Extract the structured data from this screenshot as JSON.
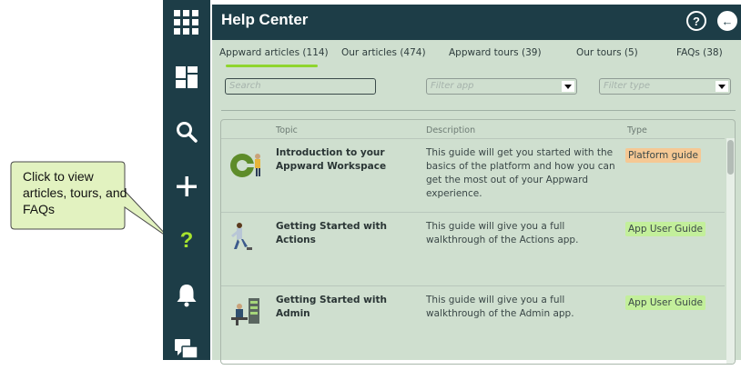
{
  "callout": {
    "text": "Click to view articles, tours, and FAQs"
  },
  "sidebar": {
    "items": [
      {
        "icon": "apps-grid-icon"
      },
      {
        "icon": "dashboard-icon"
      },
      {
        "icon": "search-icon"
      },
      {
        "icon": "plus-icon"
      },
      {
        "icon": "help-question-icon",
        "active": true
      },
      {
        "icon": "bell-icon"
      },
      {
        "icon": "chat-icon"
      }
    ],
    "active_color": "#a6e22e"
  },
  "header": {
    "title": "Help Center",
    "help_glyph": "?",
    "back_glyph": "←"
  },
  "tabs": [
    {
      "label": "Appward articles (114)",
      "active": true
    },
    {
      "label": "Our articles (474)"
    },
    {
      "label": "Appward tours (39)"
    },
    {
      "label": "Our tours (5)"
    },
    {
      "label": "FAQs (38)"
    }
  ],
  "filters": {
    "search_placeholder": "Search",
    "app_placeholder": "Filter app",
    "type_placeholder": "Filter type"
  },
  "table": {
    "columns": [
      "Topic",
      "Description",
      "Type"
    ],
    "rows": [
      {
        "topic": "Introduction to your Appward Workspace",
        "description": "This guide will get you started with the basics of the platform and how you can get the most out of your Appward experience.",
        "type": "Platform guide",
        "badge_color": "#f5c894"
      },
      {
        "topic": "Getting Started with Actions",
        "description": "This guide will give you a full walkthrough of the Actions app.",
        "type": "App User Guide",
        "badge_color": "#c3ef9b"
      },
      {
        "topic": "Getting Started with Admin",
        "description": "This guide will give you a full walkthrough of the Admin app.",
        "type": "App User Guide",
        "badge_color": "#c3ef9b"
      }
    ]
  }
}
